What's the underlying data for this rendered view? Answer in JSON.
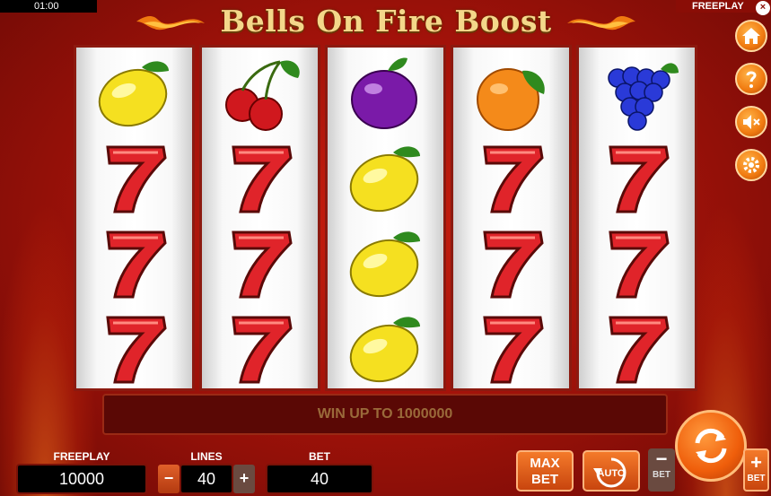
{
  "top_bar": {
    "clock": "01:00",
    "mode": "FREEPLAY",
    "close": "×"
  },
  "title": "Bells On Fire Boost",
  "reels": [
    [
      "lemon",
      "seven",
      "seven",
      "seven"
    ],
    [
      "cherries",
      "seven",
      "seven",
      "seven"
    ],
    [
      "plum",
      "lemon",
      "lemon",
      "lemon"
    ],
    [
      "orange",
      "seven",
      "seven",
      "seven"
    ],
    [
      "grapes",
      "seven",
      "seven",
      "seven"
    ]
  ],
  "message": "WIN UP TO 1000000",
  "balance": {
    "label": "FREEPLAY",
    "value": "10000"
  },
  "lines": {
    "label": "LINES",
    "value": "40",
    "minus": "−",
    "plus": "+"
  },
  "bet": {
    "label": "BET",
    "value": "40"
  },
  "buttons": {
    "max_bet_top": "MAX",
    "max_bet_bottom": "BET",
    "auto": "AUTO",
    "bet_minus": "−",
    "bet_minus_label": "BET",
    "bet_plus": "+",
    "bet_plus_label": "BET"
  },
  "sidebar_icons": [
    "home-icon",
    "help-icon",
    "sound-muted-icon",
    "settings-icon"
  ],
  "colors": {
    "background": "#a5130a",
    "reel_border": "#8c1a10",
    "accent": "#ef5e0b",
    "title": "#f4d78a",
    "message_text": "#9a6a3a"
  }
}
